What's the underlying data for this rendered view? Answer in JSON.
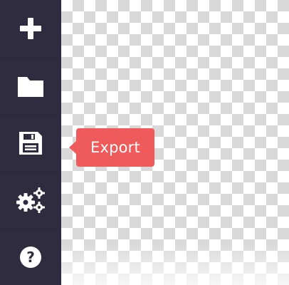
{
  "sidebar": {
    "background": "#2f2c40",
    "items": [
      {
        "id": "new",
        "icon": "plus-icon"
      },
      {
        "id": "open",
        "icon": "folder-icon"
      },
      {
        "id": "save",
        "icon": "floppy-disk-icon"
      },
      {
        "id": "settings",
        "icon": "gears-icon"
      },
      {
        "id": "help",
        "icon": "question-circle-icon"
      }
    ]
  },
  "tooltip": {
    "label": "Export",
    "color": "#ef5a5a"
  },
  "canvas": {
    "pattern": "transparent-checkerboard",
    "checker_color": "#d9d9d9"
  }
}
